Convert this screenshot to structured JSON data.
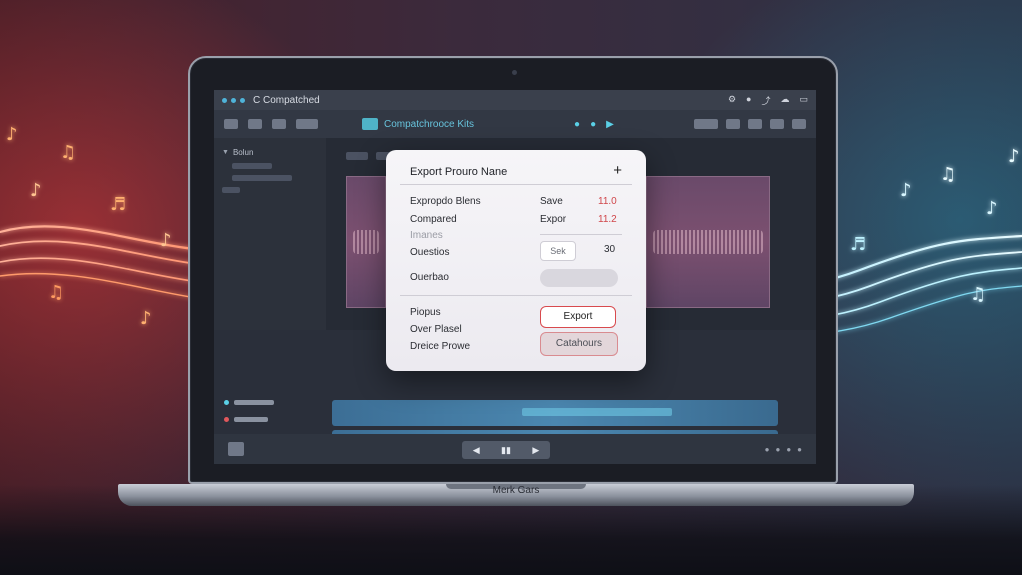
{
  "app": {
    "window_title": "C Compatched",
    "project_name": "Compatchrooce Kits",
    "base_label": "Merk Gars"
  },
  "sidebar": {
    "title": "Bolun"
  },
  "dialog": {
    "title": "Export Prouro Nane",
    "rows": [
      {
        "label": "Expropdo Blens",
        "mid": "Save",
        "value": "11.0"
      },
      {
        "label": "Compared",
        "mid": "Expor",
        "value": "11.2"
      },
      {
        "label": "Imanes",
        "muted": true
      },
      {
        "label": "Ouestios",
        "input_text": "Sek",
        "value": "30"
      },
      {
        "label": "Ouerbao"
      }
    ],
    "footer_labels": [
      "Piopus",
      "Over Plasel",
      "Dreice Prowe"
    ],
    "export_button": "Export",
    "secondary_button": "Catahours"
  },
  "colors": {
    "accent_red": "#d84a4e",
    "accent_cyan": "#5ad0e6",
    "wave_pink": "#7c5070",
    "lane_blue": "#4b87b0"
  },
  "icons": [
    "music-note-icon",
    "close-icon",
    "play-icon",
    "rewind-icon",
    "forward-icon"
  ]
}
